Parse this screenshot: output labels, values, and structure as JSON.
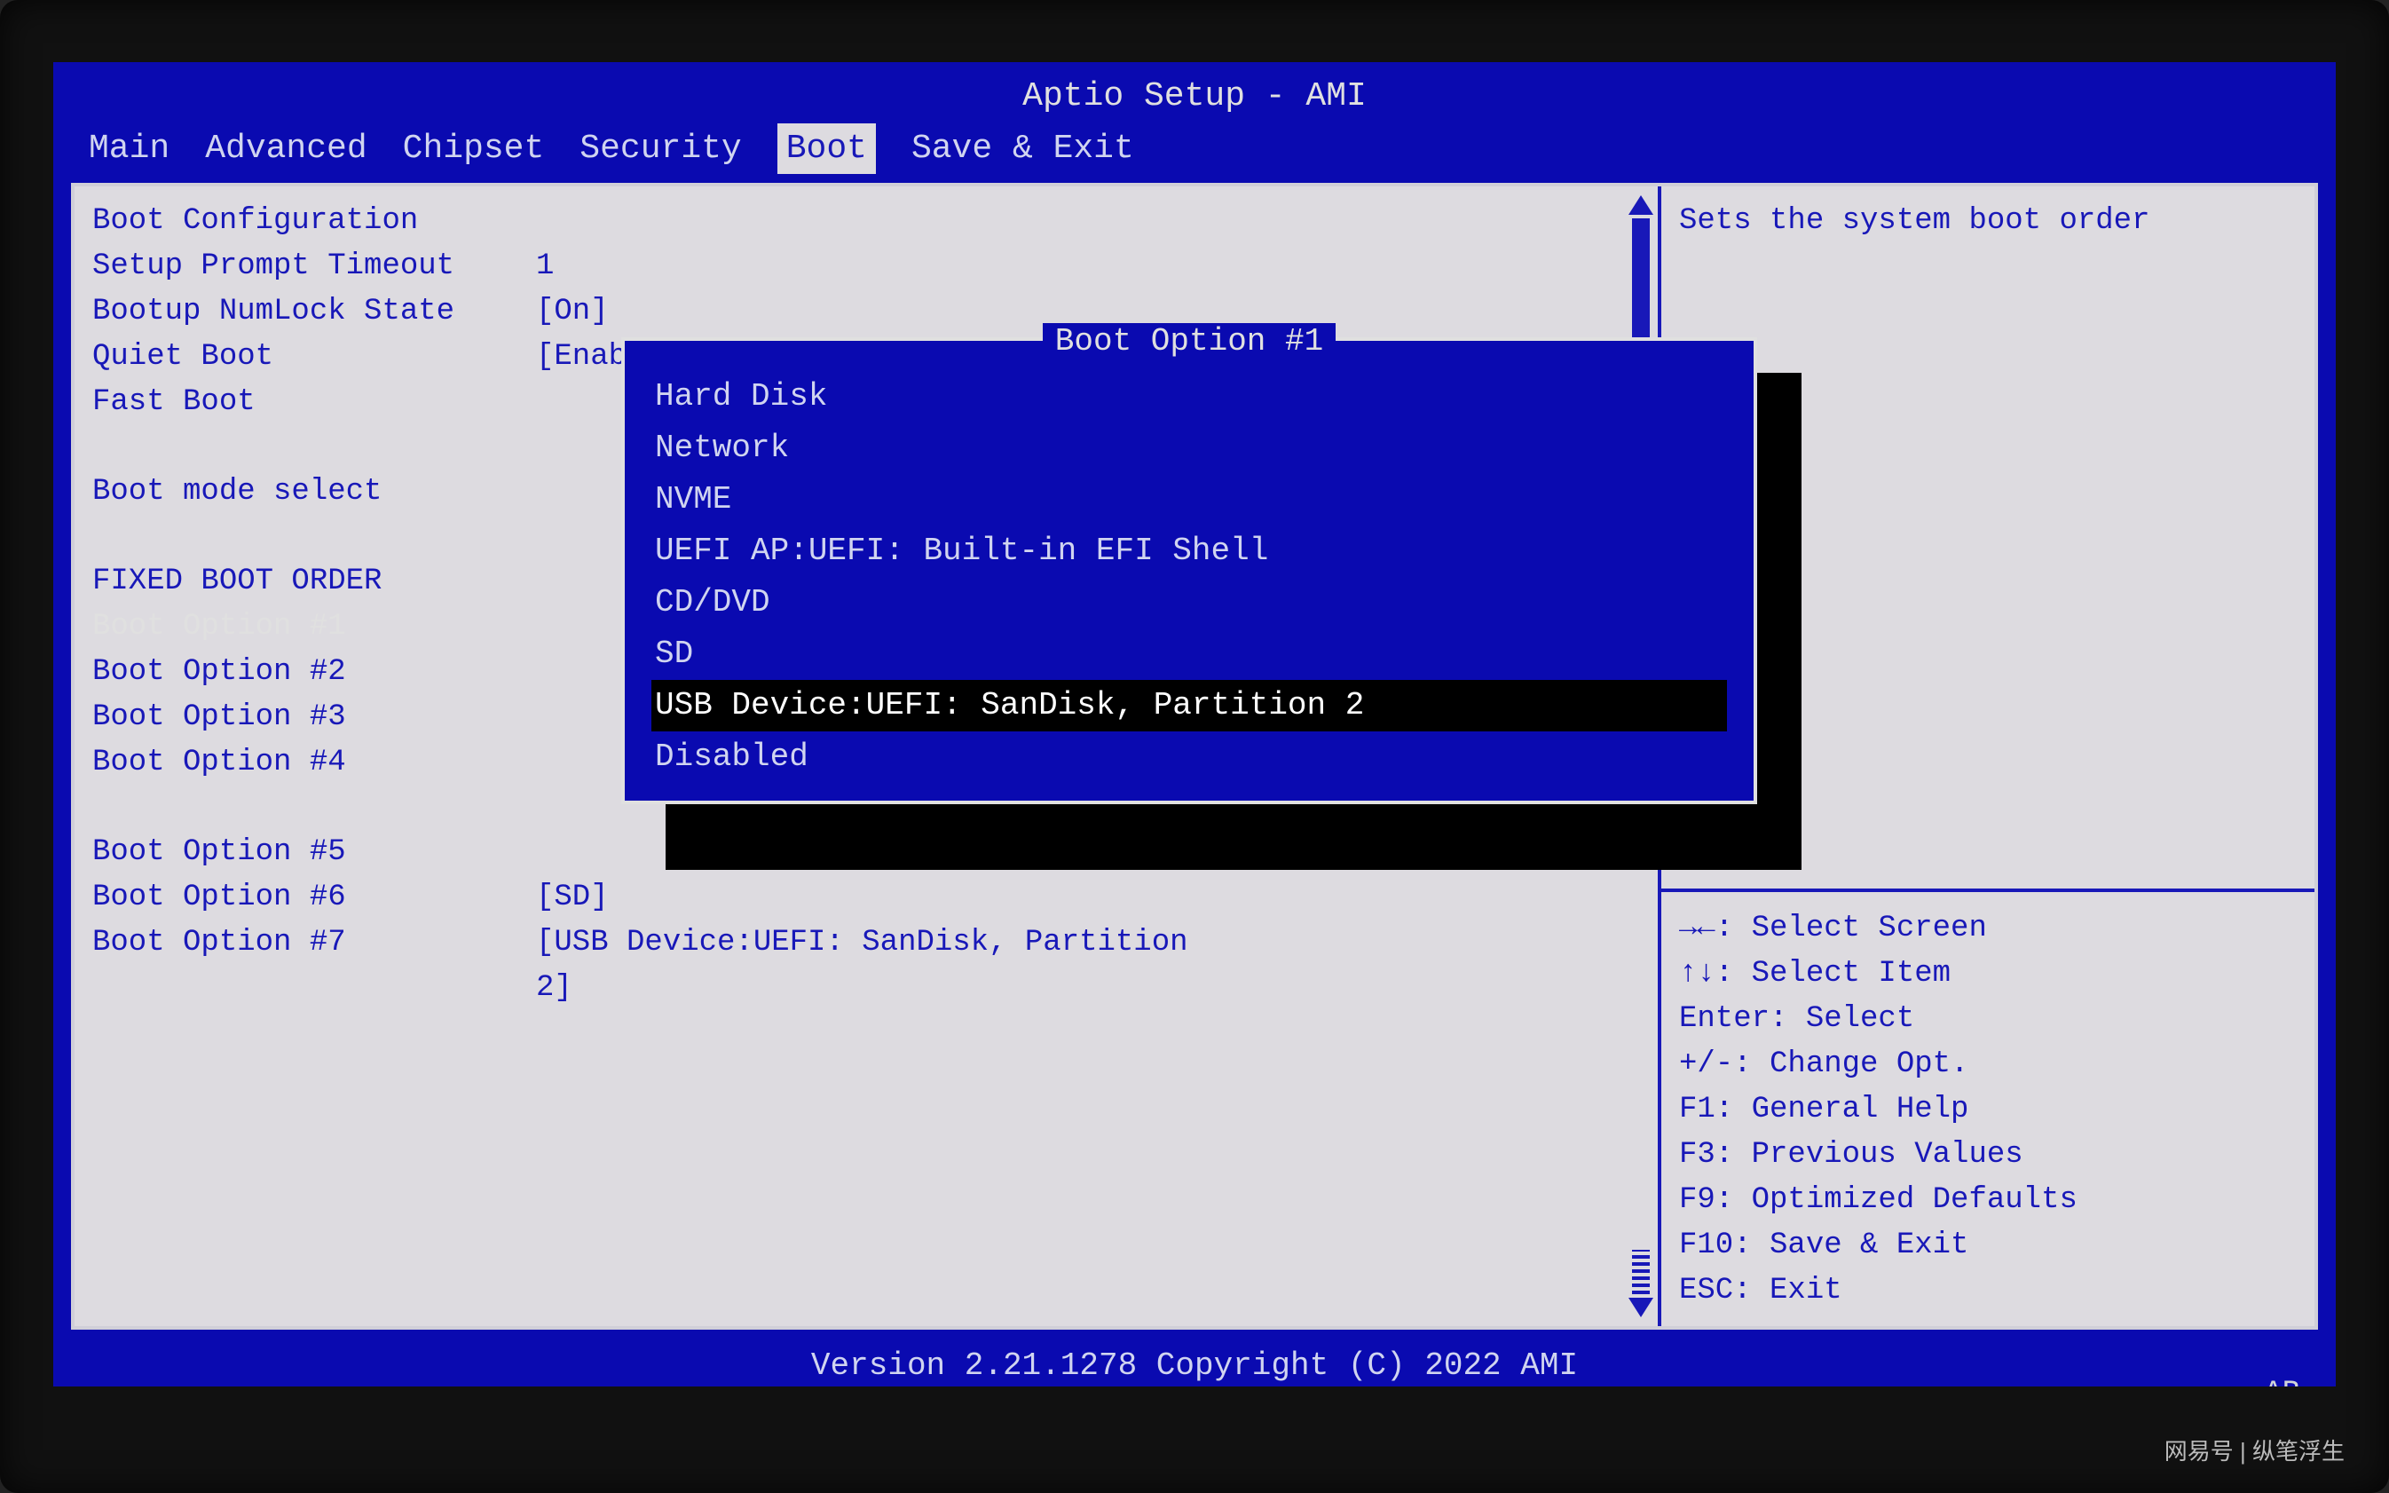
{
  "title": "Aptio Setup - AMI",
  "menu": {
    "main": "Main",
    "advanced": "Advanced",
    "chipset": "Chipset",
    "security": "Security",
    "boot": "Boot",
    "save_exit": "Save & Exit",
    "active": "Boot"
  },
  "boot_config": {
    "header": "Boot Configuration",
    "setup_prompt_timeout": {
      "label": "Setup Prompt Timeout",
      "value": "1"
    },
    "bootup_numlock_state": {
      "label": "Bootup NumLock State",
      "value": "[On]"
    },
    "quiet_boot": {
      "label": "Quiet Boot",
      "value": "[Enabled]"
    },
    "fast_boot": {
      "label": "Fast Boot",
      "value": ""
    },
    "boot_mode_select": {
      "label": "Boot mode select",
      "value": ""
    }
  },
  "fixed_order": {
    "header": "FIXED BOOT ORDER",
    "options": [
      {
        "label": "Boot Option #1",
        "value": "",
        "selected": true
      },
      {
        "label": "Boot Option #2",
        "value": ""
      },
      {
        "label": "Boot Option #3",
        "value": ""
      },
      {
        "label": "Boot Option #4",
        "value": ""
      },
      {
        "label": "Boot Option #5",
        "value": ""
      },
      {
        "label": "Boot Option #6",
        "value": "[SD]"
      },
      {
        "label": "Boot Option #7",
        "value": "[USB Device:UEFI: SanDisk, Partition 2]"
      }
    ]
  },
  "help": {
    "description": "Sets the system boot order",
    "nav": [
      "→←: Select Screen",
      "↑↓: Select Item",
      "Enter: Select",
      "+/-: Change Opt.",
      "F1: General Help",
      "F3: Previous Values",
      "F9: Optimized Defaults",
      "F10: Save & Exit",
      "ESC: Exit"
    ]
  },
  "popup": {
    "title": "Boot Option #1",
    "options": [
      "Hard Disk",
      "Network",
      "NVME",
      "UEFI AP:UEFI: Built-in EFI Shell",
      "CD/DVD",
      "SD",
      "USB Device:UEFI: SanDisk, Partition 2",
      "Disabled"
    ],
    "highlighted_index": 6
  },
  "footer": {
    "version": "Version 2.21.1278 Copyright (C) 2022 AMI",
    "tag": "AB"
  },
  "watermark": "网易号 | 纵笔浮生"
}
